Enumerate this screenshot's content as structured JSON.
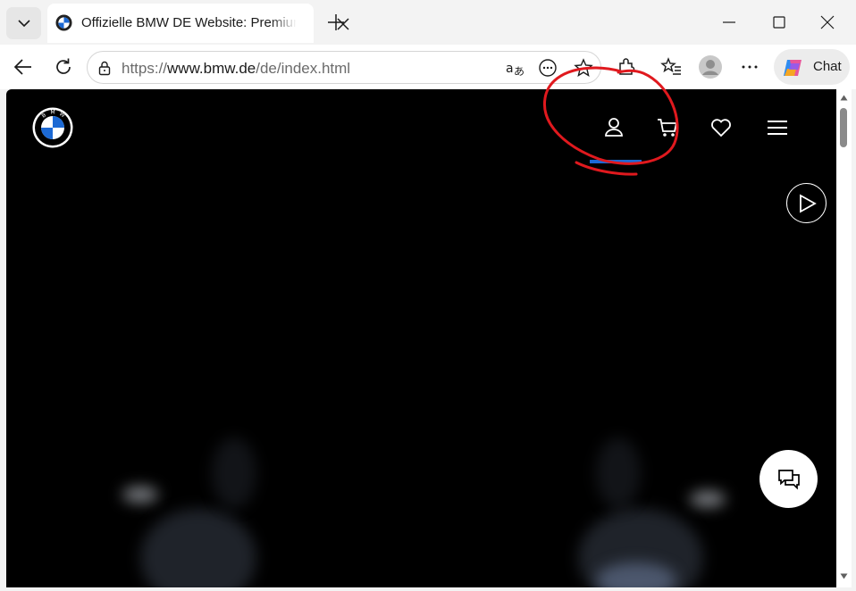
{
  "browser": {
    "tab": {
      "title": "Offizielle BMW DE Website: Premium"
    },
    "address": {
      "scheme": "https://",
      "host": "www.bmw.de",
      "path": "/de/index.html"
    },
    "chat_label": "Chat"
  },
  "page": {
    "nav_icons": [
      "user-icon",
      "cart-icon",
      "heart-icon",
      "menu-icon"
    ],
    "accent_color": "#1c69d4",
    "annotation_color": "#e0191e"
  }
}
